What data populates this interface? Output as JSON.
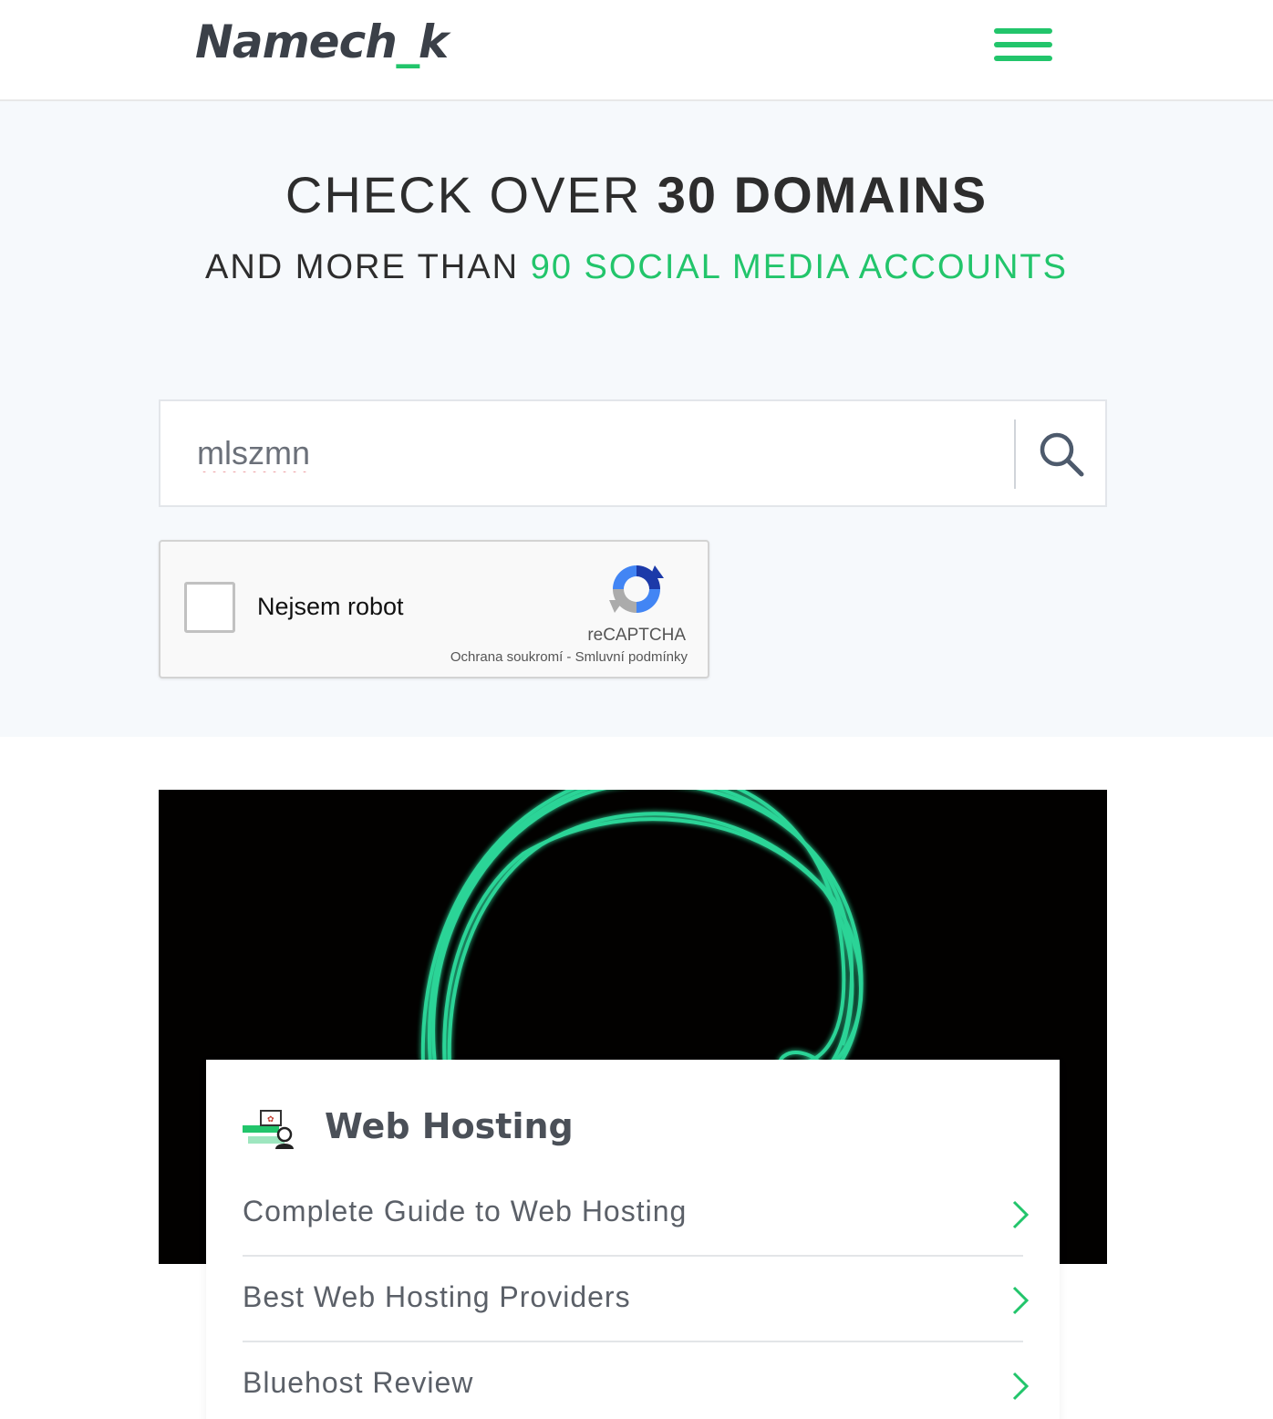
{
  "header": {
    "logo_prefix": "Namech",
    "logo_underscore": "_",
    "logo_suffix": "k",
    "menu_icon": "hamburger-menu-icon"
  },
  "hero": {
    "headline_light": "CHECK OVER ",
    "headline_bold": "30 DOMAINS",
    "subline_dark": "AND MORE THAN ",
    "subline_green": "90 SOCIAL MEDIA ACCOUNTS"
  },
  "search": {
    "value": "mlszmn",
    "button_icon": "search-icon"
  },
  "captcha": {
    "label": "Nejsem robot",
    "brand": "reCAPTCHA",
    "privacy": "Ochrana soukromí",
    "separator": " - ",
    "terms": "Smluvní podmínky"
  },
  "card": {
    "icon": "web-hosting-icon",
    "title": "Web Hosting",
    "links": [
      {
        "label": "Complete Guide to Web Hosting"
      },
      {
        "label": "Best Web Hosting Providers"
      },
      {
        "label": "Bluehost Review"
      }
    ]
  },
  "colors": {
    "accent": "#22c56b",
    "hero_bg": "#f6f9fc",
    "text_dark": "#2d2d2d",
    "banner_bg": "#020100"
  }
}
